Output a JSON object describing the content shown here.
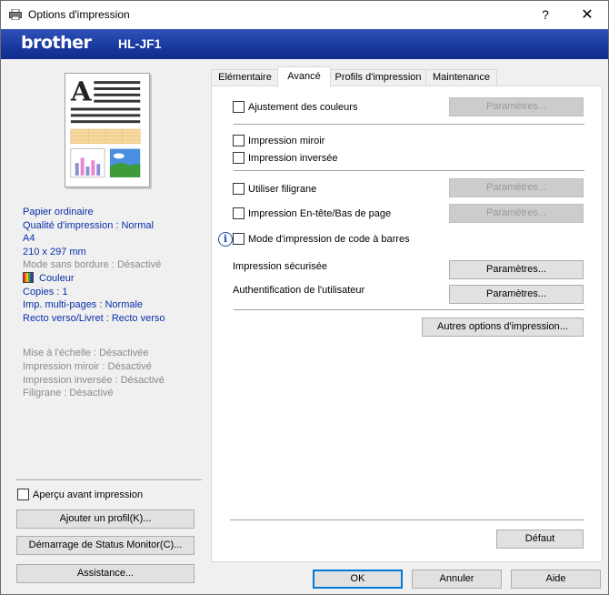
{
  "window": {
    "title": "Options d'impression",
    "help": "?",
    "close": "✕"
  },
  "banner": {
    "logo": "brother",
    "model": "HL-JF1"
  },
  "summary": {
    "media": "Papier ordinaire",
    "quality": "Qualité d'impression : Normal",
    "size": "A4",
    "dimensions": "210 x 297 mm",
    "borderless": "Mode sans bordure : Désactivé",
    "color": "Couleur",
    "copies": "Copies : 1",
    "multipage": "Imp. multi-pages : Normale",
    "duplex": "Recto verso/Livret : Recto verso",
    "scaling": "Mise à l'échelle : Désactivée",
    "mirror": "Impression miroir : Désactivé",
    "reverse": "Impression inversée : Désactivé",
    "watermark": "Filigrane : Désactivé"
  },
  "left_controls": {
    "preview_label": "Aperçu avant impression",
    "add_profile": "Ajouter un profil(K)...",
    "status_monitor": "Démarrage de Status Monitor(C)...",
    "support": "Assistance..."
  },
  "tabs": [
    "Elémentaire",
    "Avancé",
    "Profils d'impression",
    "Maintenance"
  ],
  "advanced": {
    "color_adjust": "Ajustement des couleurs",
    "mirror_print": "Impression miroir",
    "reverse_print": "Impression inversée",
    "use_watermark": "Utiliser filigrane",
    "header_footer": "Impression En-tête/Bas de page",
    "barcode_mode": "Mode d'impression de code à barres",
    "secure_print": "Impression sécurisée",
    "user_auth": "Authentification de l'utilisateur",
    "settings": "Paramètres...",
    "other_options": "Autres options d'impression...",
    "default": "Défaut"
  },
  "footer": {
    "ok": "OK",
    "cancel": "Annuler",
    "help": "Aide"
  },
  "colors": {
    "banner": "#1a3aa2",
    "link_blue": "#0a2fa8",
    "focus": "#0078d7"
  }
}
